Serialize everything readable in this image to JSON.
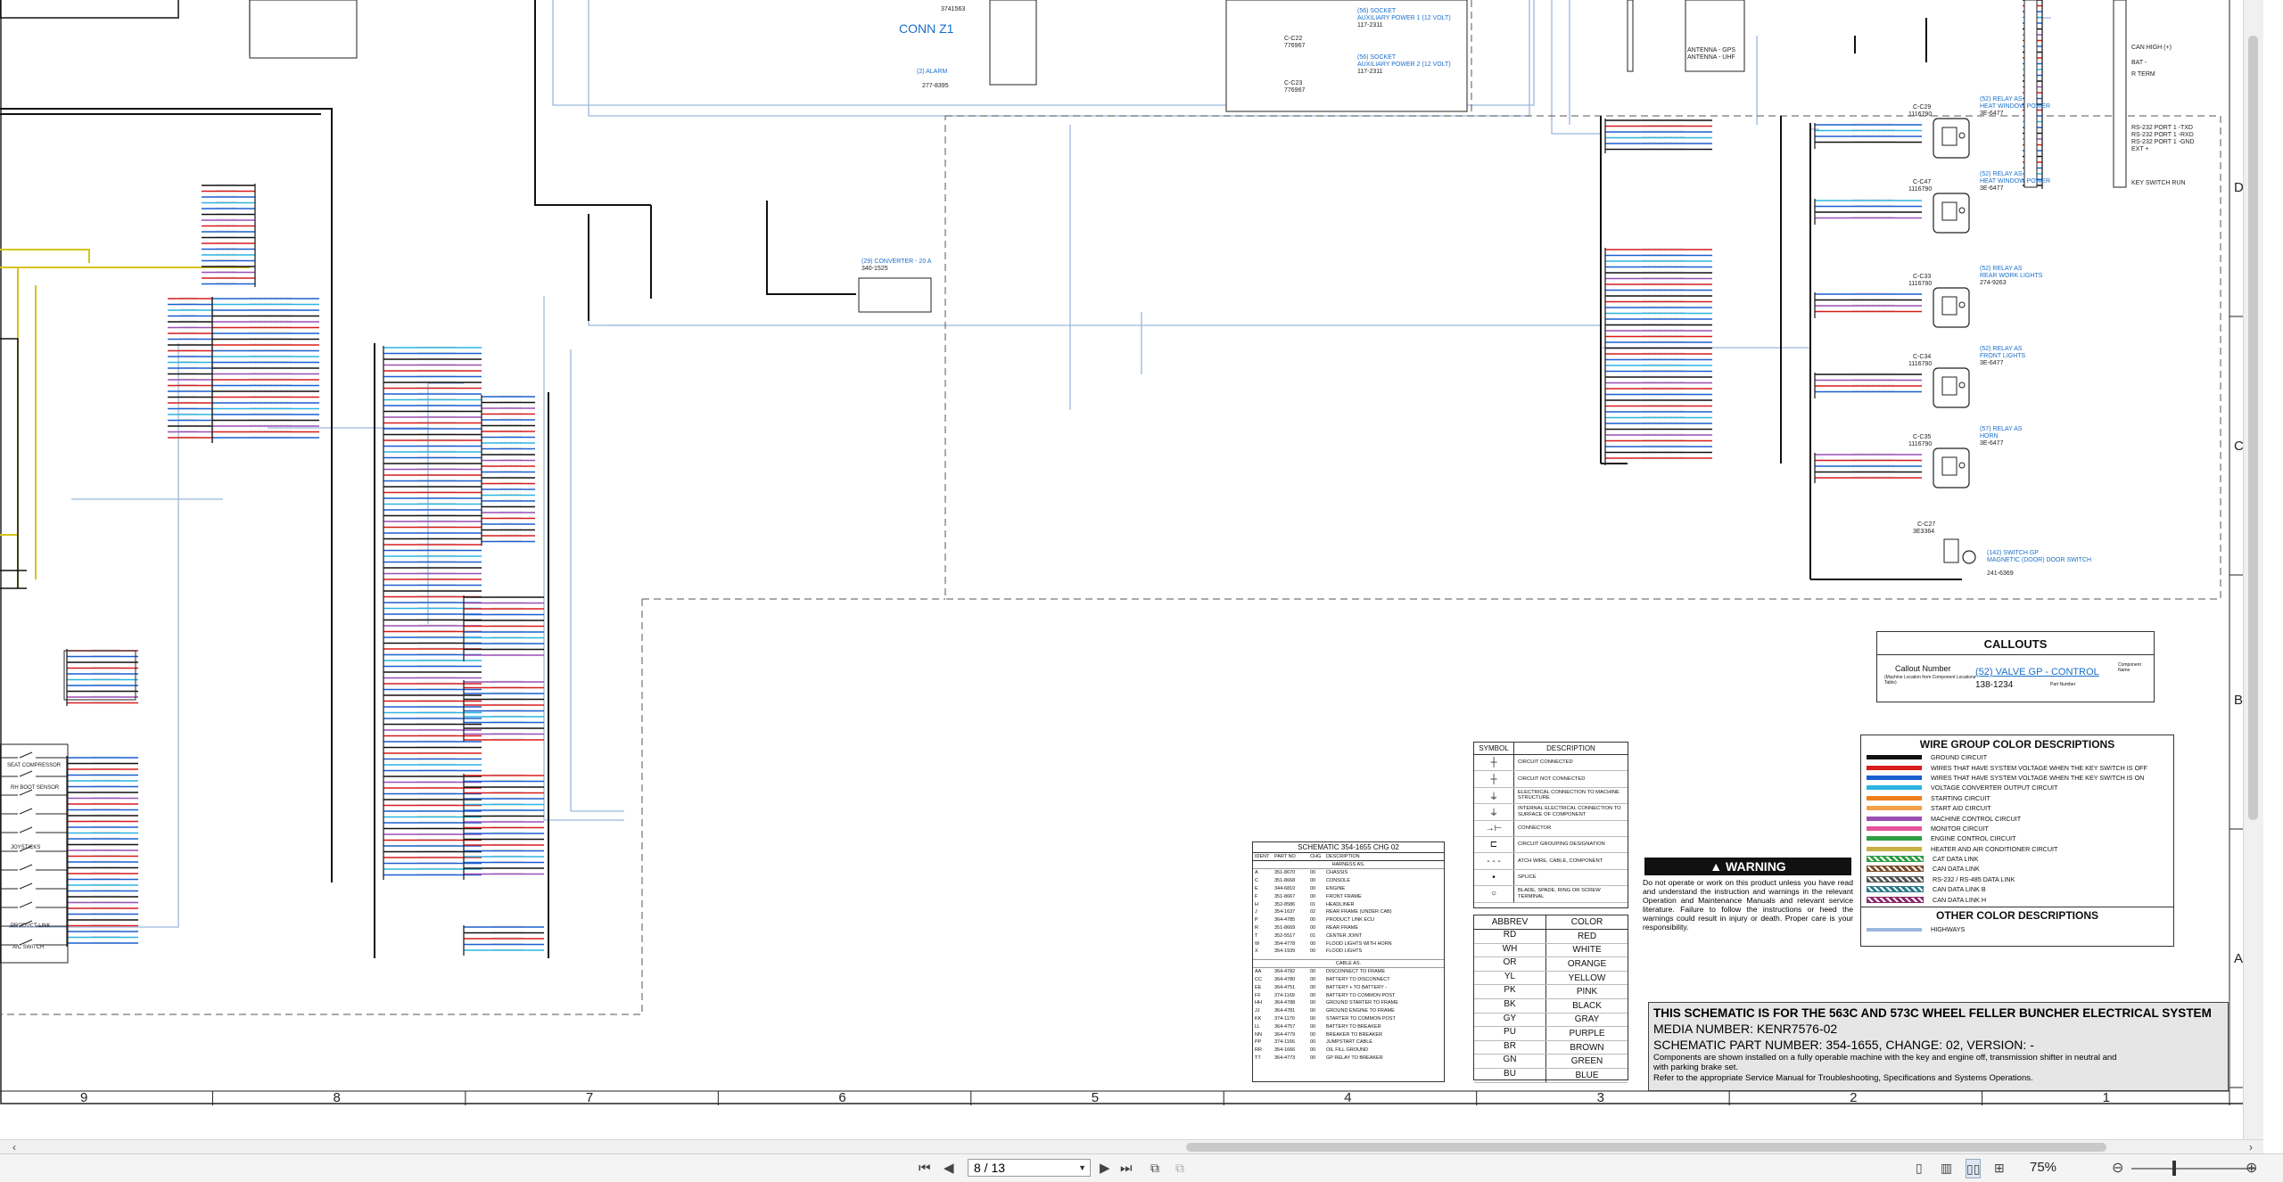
{
  "zones": {
    "columns": [
      "9",
      "8",
      "7",
      "6",
      "5",
      "4",
      "3",
      "2",
      "1"
    ],
    "rows": [
      "D",
      "C",
      "B",
      "A"
    ]
  },
  "wiring_labels": {
    "conn_z1": "CONN Z1",
    "conn_z1_part": "3741563",
    "converter_callout": "(29) CONVERTER - 20 A",
    "converter_part": "340-1525",
    "socket_1": "(56) SOCKET",
    "socket_1_desc": "AUXILIARY POWER 1 (12 VOLT)",
    "socket_1_part": "117-2311",
    "socket_2": "(56) SOCKET",
    "socket_2_desc": "AUXILIARY POWER 2 (12 VOLT)",
    "socket_2_part": "117-2311",
    "connector_c22": "C-C22",
    "connector_c22_part": "776967",
    "connector_c23": "C-C23",
    "connector_c23_part": "776967",
    "alarm_callout": "(2) ALARM",
    "alarm_part": "277-8395",
    "antenna_gps": "ANTENNA - GPS",
    "antenna_uhf": "ANTENNA - UHF",
    "can_high": "CAN HIGH (+)",
    "bat_minus": "BAT -",
    "r_term": "R TERM",
    "rs232_1": "RS-232 PORT 1 -TXD",
    "rs232_2": "RS-232 PORT 1 -RXD",
    "rs232_3": "RS-232 PORT 1 -GND",
    "ext": "EXT +",
    "key_switch_run": "KEY SWITCH RUN",
    "relay_1": "(52) RELAY AS",
    "relay_1_desc": "HEAT WINDOW POWER",
    "relay_1_conn": "C-C29",
    "relay_1_conn_part": "1116790",
    "relay_1_part": "3E-6477",
    "relay_2": "(52) RELAY AS",
    "relay_2_desc": "HEAT WINDOW POWER",
    "relay_2_conn": "C-C47",
    "relay_2_conn_part": "1116790",
    "relay_2_part": "3E-6477",
    "relay_3": "(52) RELAY AS",
    "relay_3_desc": "REAR WORK LIGHTS",
    "relay_3_conn": "C-C33",
    "relay_3_conn_part": "1116790",
    "relay_3_part": "274-9263",
    "relay_4": "(52) RELAY AS",
    "relay_4_desc": "FRONT LIGHTS",
    "relay_4_conn": "C-C34",
    "relay_4_conn_part": "1116790",
    "relay_4_part": "3E-6477",
    "relay_5": "(57) RELAY AS",
    "relay_5_desc": "HORN",
    "relay_5_conn": "C-C35",
    "relay_5_conn_part": "1116790",
    "relay_5_part": "3E-6477",
    "switch_gp": "(142) SWITCH GP",
    "switch_gp_desc": "MAGNETIC (DOOR) DOOR SWITCH",
    "switch_gp_conn": "C-C27",
    "switch_gp_conn_part": "3E3364",
    "switch_gp_part": "241-6369",
    "seat_compressor": "SEAT COMPRESSOR",
    "rh_boot_sensor": "RH BOOT SENSOR",
    "joysticks": "JOYSTICKS",
    "product_link": "PRODUCT LINK",
    "ac_switch": "A/C SWITCH"
  },
  "callouts": {
    "title": "CALLOUTS",
    "callout_number": "Callout Number",
    "callout_number_sub": "(Machine Location from Component Locations Table)",
    "example_callout": "(52) VALVE GP - CONTROL",
    "example_part": "138-1234",
    "component_name": "Component Name",
    "part_number": "Part Number"
  },
  "wire_groups": {
    "title": "WIRE GROUP COLOR DESCRIPTIONS",
    "items": [
      {
        "label": "GROUND CIRCUIT",
        "color": "#111111"
      },
      {
        "label": "WIRES THAT HAVE SYSTEM VOLTAGE WHEN THE KEY SWITCH IS OFF",
        "color": "#d81b1b"
      },
      {
        "label": "WIRES THAT HAVE SYSTEM VOLTAGE WHEN THE KEY SWITCH IS ON",
        "color": "#1a5fd1"
      },
      {
        "label": "VOLTAGE CONVERTER OUTPUT CIRCUIT",
        "color": "#2bb5e0"
      },
      {
        "label": "STARTING CIRCUIT",
        "color": "#f07d1c"
      },
      {
        "label": "START AID CIRCUIT",
        "color": "#f2a04a"
      },
      {
        "label": "MACHINE CONTROL CIRCUIT",
        "color": "#9b4fb5"
      },
      {
        "label": "MONITOR CIRCUIT",
        "color": "#e8549a"
      },
      {
        "label": "ENGINE CONTROL CIRCUIT",
        "color": "#2f9e44"
      },
      {
        "label": "HEATER AND AIR CONDITIONER CIRCUIT",
        "color": "#c9b046"
      },
      {
        "label": "CAT DATA LINK",
        "color": "#2f9e44"
      },
      {
        "label": "CAN DATA LINK",
        "color": "#7a4b2a"
      },
      {
        "label": "RS-232 / RS-485 DATA LINK",
        "color": "#555555"
      },
      {
        "label": "CAN DATA LINK B",
        "color": "#2a7a8a"
      },
      {
        "label": "CAN DATA LINK H",
        "color": "#8a2a6a"
      }
    ],
    "other_title": "OTHER COLOR DESCRIPTIONS",
    "other_items": [
      {
        "label": "HIGHWAYS",
        "color": "#9bb7dd"
      }
    ]
  },
  "symbols": {
    "col_symbol": "SYMBOL",
    "col_description": "DESCRIPTION",
    "items": [
      {
        "glyph": "┼",
        "label": "CIRCUIT CONNECTED"
      },
      {
        "glyph": "┼",
        "label": "CIRCUIT NOT CONNECTED"
      },
      {
        "glyph": "⏚",
        "label": "ELECTRICAL CONNECTION TO MACHINE STRUCTURE"
      },
      {
        "glyph": "⏚",
        "label": "INTERNAL ELECTRICAL CONNECTION TO SURFACE OF COMPONENT"
      },
      {
        "glyph": "→⊢",
        "label": "CONNECTOR"
      },
      {
        "glyph": "⊏",
        "label": "CIRCUIT GROUPING DESIGNATION"
      },
      {
        "glyph": "- - -",
        "label": "ATCH WIRE, CABLE, COMPONENT"
      },
      {
        "glyph": "•",
        "label": "SPLICE"
      },
      {
        "glyph": "○",
        "label": "BLADE, SPADE, RING OR SCREW TERMINAL"
      }
    ]
  },
  "abbrev": {
    "col_abbrev": "ABBREV",
    "col_color": "COLOR",
    "items": [
      {
        "abbrev": "RD",
        "color": "RED"
      },
      {
        "abbrev": "WH",
        "color": "WHITE"
      },
      {
        "abbrev": "OR",
        "color": "ORANGE"
      },
      {
        "abbrev": "YL",
        "color": "YELLOW"
      },
      {
        "abbrev": "PK",
        "color": "PINK"
      },
      {
        "abbrev": "BK",
        "color": "BLACK"
      },
      {
        "abbrev": "GY",
        "color": "GRAY"
      },
      {
        "abbrev": "PU",
        "color": "PURPLE"
      },
      {
        "abbrev": "BR",
        "color": "BROWN"
      },
      {
        "abbrev": "GN",
        "color": "GREEN"
      },
      {
        "abbrev": "BU",
        "color": "BLUE"
      }
    ]
  },
  "schematic_table": {
    "title": "SCHEMATIC 354-1655 CHG 02",
    "cols": [
      "IDENT",
      "PART NO",
      "CHG",
      "DESCRIPTION"
    ],
    "harness_header": "HARNESS AS.",
    "harness": [
      [
        "A",
        "351-8670",
        "00",
        "CHASSIS"
      ],
      [
        "C",
        "351-8668",
        "00",
        "CONSOLE"
      ],
      [
        "E",
        "344-6810",
        "00",
        "ENGINE"
      ],
      [
        "F",
        "351-8667",
        "00",
        "FRONT FRAME"
      ],
      [
        "H",
        "352-8586",
        "01",
        "HEADLINER"
      ],
      [
        "J",
        "354-1637",
        "02",
        "REAR FRAME (UNDER CAB)"
      ],
      [
        "P",
        "364-4785",
        "00",
        "PRODUCT LINK ECU"
      ],
      [
        "R",
        "351-8669",
        "00",
        "REAR FRAME"
      ],
      [
        "T",
        "352-5517",
        "01",
        "CENTER JOINT"
      ],
      [
        "W",
        "354-4778",
        "00",
        "FLOOD LIGHTS WITH HORN"
      ],
      [
        "X",
        "354-1939",
        "00",
        "FLOOD LIGHTS"
      ]
    ],
    "cable_header": "CABLE AS.",
    "cable": [
      [
        "AA",
        "364-4782",
        "00",
        "DISCONNECT TO FRAME"
      ],
      [
        "CC",
        "364-4780",
        "00",
        "BATTERY TO DISCONNECT"
      ],
      [
        "EE",
        "364-4751",
        "00",
        "BATTERY + TO BATTERY -"
      ],
      [
        "FF",
        "374-1169",
        "00",
        "BATTERY TO COMMON POST"
      ],
      [
        "HH",
        "364-4788",
        "00",
        "GROUND STARTER TO FRAME"
      ],
      [
        "JJ",
        "364-4781",
        "00",
        "GROUND ENGINE TO FRAME"
      ],
      [
        "KK",
        "374-1170",
        "00",
        "STARTER TO COMMON POST"
      ],
      [
        "LL",
        "364-4757",
        "00",
        "BATTERY TO BREAKER"
      ],
      [
        "NN",
        "364-4779",
        "00",
        "BREAKER TO BREAKER"
      ],
      [
        "PP",
        "374-1166",
        "00",
        "JUMPSTART CABLE"
      ],
      [
        "RR",
        "354-1666",
        "00",
        "OIL FILL GROUND"
      ],
      [
        "TT",
        "364-4773",
        "00",
        "GP RELAY TO BREAKER"
      ]
    ]
  },
  "warning": {
    "title": "WARNING",
    "text": "Do not operate or work on this product unless you have read and understand the instruction and warnings in the relevant Operation and Maintenance Manuals and relevant service literature. Failure to follow the instructions or heed the warnings could result in injury or death. Proper care is your responsibility."
  },
  "title_block": {
    "line1": "THIS SCHEMATIC IS FOR THE 563C AND 573C WHEEL FELLER BUNCHER ELECTRICAL SYSTEM",
    "line2": "MEDIA NUMBER: KENR7576-02",
    "line3": "SCHEMATIC PART NUMBER: 354-1655, CHANGE: 02, VERSION: -",
    "line4": "Components are shown installed on a fully operable machine with the key and engine off, transmission shifter in neutral and with parking brake set.",
    "line5": "Refer to the appropriate Service Manual for Troubleshooting, Specifications and Systems Operations."
  },
  "toolbar": {
    "page_value": "8 / 13",
    "zoom": "75%"
  },
  "colors": {
    "ground": "#111111",
    "red": "#d81b1b",
    "blue": "#1a5fd1",
    "cyan": "#2bb5e0",
    "purple": "#9b4fb5",
    "yellow": "#d6c21a",
    "highway": "#9bb7dd",
    "link": "#1a6fc9"
  }
}
